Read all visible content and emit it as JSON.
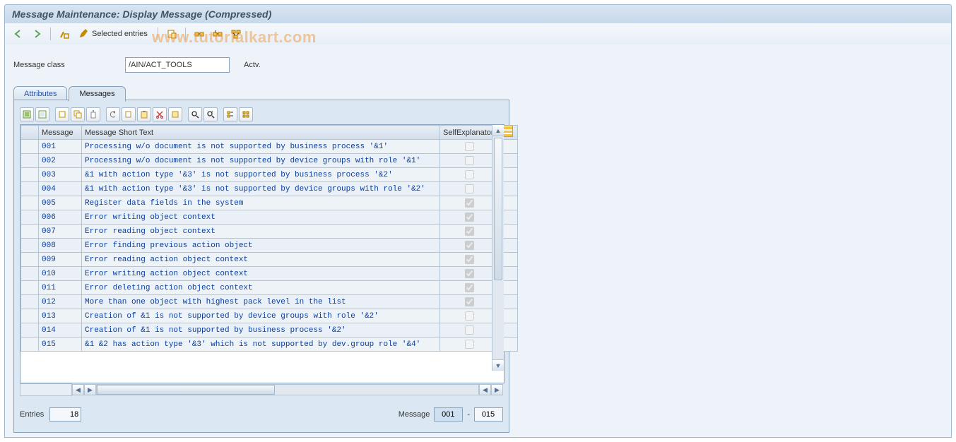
{
  "title": "Message Maintenance: Display Message (Compressed)",
  "watermark": "www.tutorialkart.com",
  "toolbar": {
    "selected_entries_label": "Selected entries"
  },
  "field": {
    "message_class_label": "Message class",
    "message_class_value": "/AIN/ACT_TOOLS",
    "status": "Actv."
  },
  "tabs": [
    {
      "id": "attributes",
      "label": "Attributes",
      "active": false
    },
    {
      "id": "messages",
      "label": "Messages",
      "active": true
    }
  ],
  "grid": {
    "headers": {
      "message": "Message",
      "short_text": "Message Short Text",
      "self_explanatory": "SelfExplanatory"
    },
    "rows": [
      {
        "msg": "001",
        "text": "Processing w/o document is not supported by business process '&1'",
        "self": false
      },
      {
        "msg": "002",
        "text": "Processing w/o document is not supported by device groups with role '&1'",
        "self": false
      },
      {
        "msg": "003",
        "text": "&1 with action type '&3' is not supported by business process '&2'",
        "self": false
      },
      {
        "msg": "004",
        "text": "&1 with action type '&3' is not supported by device groups with role '&2'",
        "self": false
      },
      {
        "msg": "005",
        "text": "Register data fields in the system",
        "self": true
      },
      {
        "msg": "006",
        "text": "Error writing object context",
        "self": true
      },
      {
        "msg": "007",
        "text": "Error reading object context",
        "self": true
      },
      {
        "msg": "008",
        "text": "Error finding previous action object",
        "self": true
      },
      {
        "msg": "009",
        "text": "Error reading action object context",
        "self": true
      },
      {
        "msg": "010",
        "text": "Error writing action object context",
        "self": true
      },
      {
        "msg": "011",
        "text": "Error deleting action object context",
        "self": true
      },
      {
        "msg": "012",
        "text": "More than one object with highest pack level in the list",
        "self": true
      },
      {
        "msg": "013",
        "text": "Creation of &1 is not supported by device groups with role '&2'",
        "self": false
      },
      {
        "msg": "014",
        "text": "Creation of &1 is not supported by business process '&2'",
        "self": false
      },
      {
        "msg": "015",
        "text": "&1 &2 has action type '&3' which is not supported by dev.group role '&4'",
        "self": false
      }
    ]
  },
  "footer": {
    "entries_label": "Entries",
    "entries_value": "18",
    "message_label": "Message",
    "from": "001",
    "to": "015"
  }
}
